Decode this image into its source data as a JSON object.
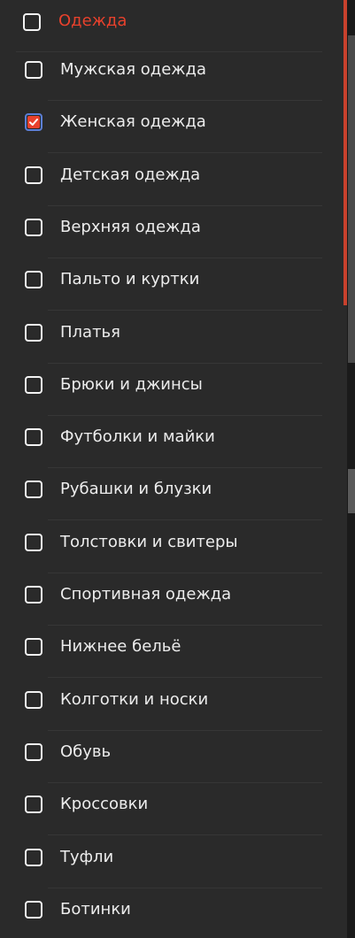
{
  "filter": {
    "header": {
      "label": "Одежда",
      "checked": false
    },
    "items": [
      {
        "label": "Мужская одежда",
        "checked": false
      },
      {
        "label": "Женская одежда",
        "checked": true
      },
      {
        "label": "Детская одежда",
        "checked": false
      },
      {
        "label": "Верхняя одежда",
        "checked": false
      },
      {
        "label": "Пальто и куртки",
        "checked": false
      },
      {
        "label": "Платья",
        "checked": false
      },
      {
        "label": "Брюки и джинсы",
        "checked": false
      },
      {
        "label": "Футболки и майки",
        "checked": false
      },
      {
        "label": "Рубашки и блузки",
        "checked": false
      },
      {
        "label": "Толстовки и свитеры",
        "checked": false
      },
      {
        "label": "Спортивная одежда",
        "checked": false
      },
      {
        "label": "Нижнее бельё",
        "checked": false
      },
      {
        "label": "Колготки и носки",
        "checked": false
      },
      {
        "label": "Обувь",
        "checked": false
      },
      {
        "label": "Кроссовки",
        "checked": false
      },
      {
        "label": "Туфли",
        "checked": false
      },
      {
        "label": "Ботинки",
        "checked": false
      }
    ]
  },
  "colors": {
    "background": "#2a2a2a",
    "accent": "#e8412c",
    "checkbox_focus_border": "#5b7fd6",
    "text": "#ececec"
  }
}
